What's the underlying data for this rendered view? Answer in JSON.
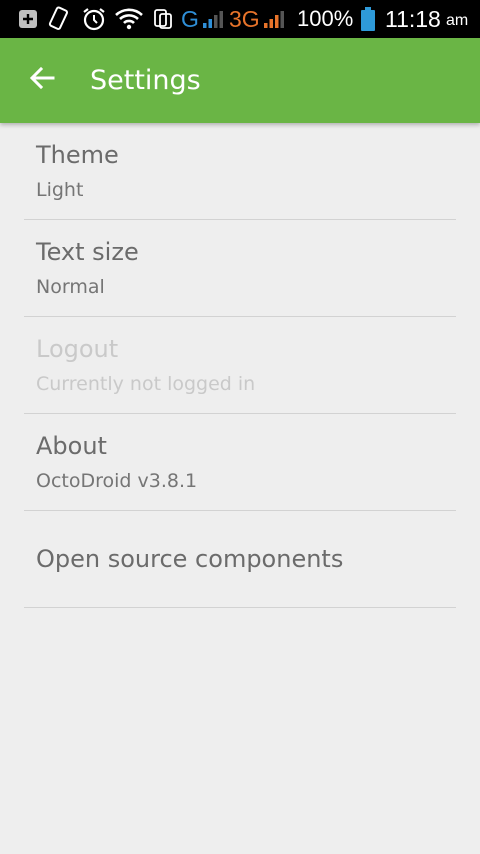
{
  "status_bar": {
    "network_g": "G",
    "network_3g": "3G",
    "battery": "100%",
    "time": "11:18",
    "ampm": "am",
    "colors": {
      "g_blue": "#2f8fd8",
      "threeg_orange": "#e8742a",
      "battery_blue": "#2e9ad9"
    }
  },
  "app_bar": {
    "title": "Settings",
    "color": "#6ab545"
  },
  "preferences": [
    {
      "title": "Theme",
      "summary": "Light"
    },
    {
      "title": "Text size",
      "summary": "Normal"
    },
    {
      "title": "Logout",
      "summary": "Currently not logged in"
    },
    {
      "title": "About",
      "summary": "OctoDroid v3.8.1"
    },
    {
      "title": "Open source components"
    }
  ]
}
